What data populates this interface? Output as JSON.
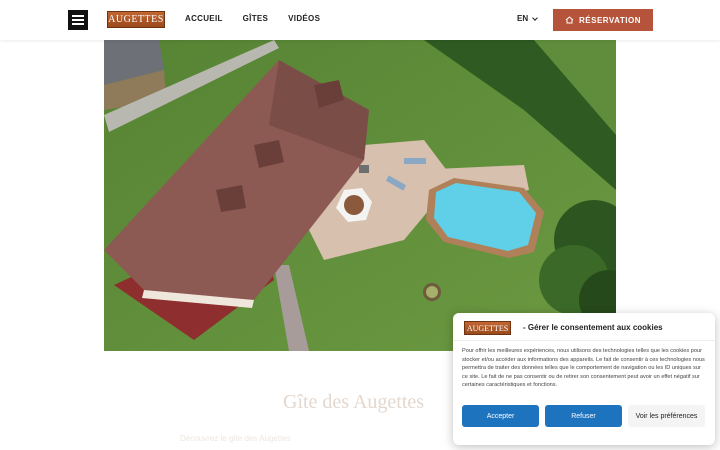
{
  "header": {
    "logo_text": "AUGETTES",
    "nav": [
      "ACCUEIL",
      "GÎTES",
      "VIDÉOS"
    ],
    "lang": "EN",
    "reservation_label": "RÉSERVATION"
  },
  "page": {
    "title": "Gîte des Augettes",
    "subtitle": "Découvrez le gîte des Augettes"
  },
  "cookie_banner": {
    "logo_text": "AUGETTES",
    "title": "- Gérer le consentement aux cookies",
    "body": "Pour offrir les meilleures expériences, nous utilisons des technologies telles que les cookies pour stocker et/ou accéder aux informations des appareils. Le fait de consentir à ces technologies nous permettra de traiter des données telles que le comportement de navigation ou les ID uniques sur ce site. Le fait de ne pas consentir ou de retirer son consentement peut avoir un effet négatif sur certaines caractéristiques et fonctions.",
    "accept_label": "Accepter",
    "refuse_label": "Refuser",
    "prefs_label": "Voir les préférences"
  },
  "colors": {
    "accent": "#b5543a",
    "button_blue": "#1e73be"
  },
  "icons": {
    "menu": "hamburger-icon",
    "home": "home-icon",
    "chevron": "chevron-down-icon"
  }
}
